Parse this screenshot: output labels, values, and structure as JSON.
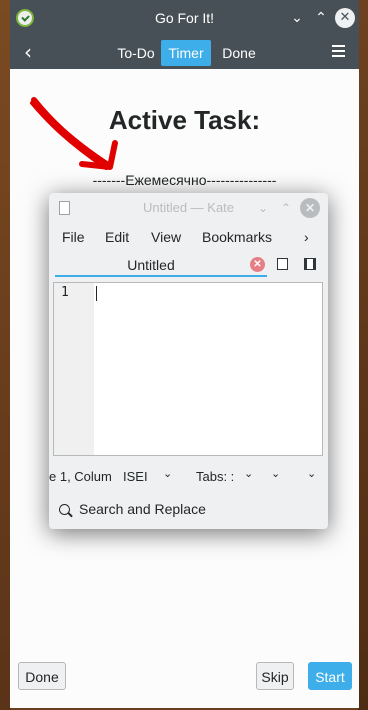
{
  "go_for_it": {
    "title": "Go For It!",
    "titlebar_buttons": {
      "minimize": "⌄",
      "maximize": "⌃",
      "close": "✕"
    },
    "toolbar": {
      "back": "‹",
      "tabs": [
        {
          "label": "To-Do",
          "active": false
        },
        {
          "label": "Timer",
          "active": true
        },
        {
          "label": "Done",
          "active": false
        }
      ]
    },
    "heading": "Active Task:",
    "task": "-------Ежемесячно---------------",
    "buttons": {
      "done": "Done",
      "skip": "Skip",
      "start": "Start"
    },
    "colors": {
      "accent": "#3daee9",
      "titlebar": "#475057",
      "arrow": "#e00000"
    }
  },
  "kate": {
    "title": "Untitled — Kate",
    "titlebar_buttons": {
      "minimize": "⌄",
      "maximize": "⌃",
      "close": "✕"
    },
    "menu": [
      "File",
      "Edit",
      "View",
      "Bookmarks",
      "›"
    ],
    "tab": {
      "label": "Untitled",
      "close": "✕"
    },
    "editor": {
      "line_number": "1"
    },
    "status": {
      "position": "e 1, Colum",
      "mode": "ISEI",
      "tabs": "Tabs: :"
    },
    "search_label": "Search and Replace"
  }
}
